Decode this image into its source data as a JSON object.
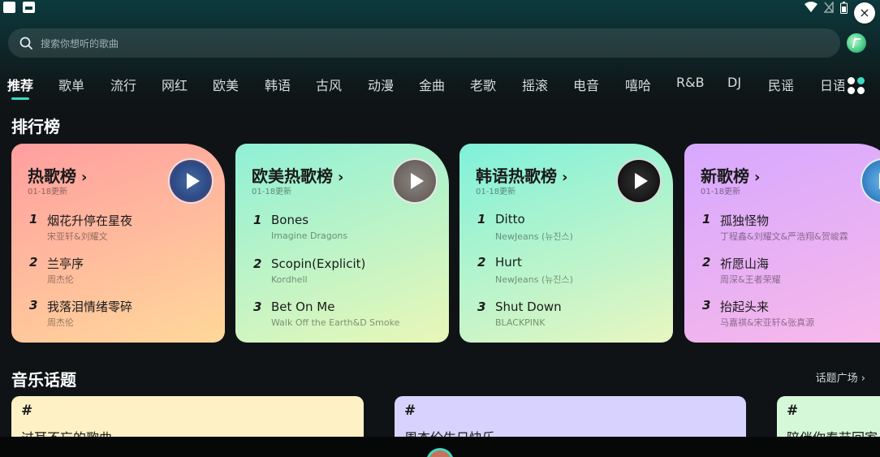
{
  "status_bar": {
    "left_icons": [
      "notification-icon",
      "image-icon"
    ],
    "right_icons": [
      "wifi-icon",
      "no-signal-icon",
      "battery-icon"
    ]
  },
  "overlay": {
    "close_label": "×"
  },
  "search": {
    "placeholder": "搜索你想听的歌曲"
  },
  "tabs": [
    {
      "label": "推荐",
      "active": true
    },
    {
      "label": "歌单"
    },
    {
      "label": "流行"
    },
    {
      "label": "网红"
    },
    {
      "label": "欧美"
    },
    {
      "label": "韩语"
    },
    {
      "label": "古风"
    },
    {
      "label": "动漫"
    },
    {
      "label": "金曲"
    },
    {
      "label": "老歌"
    },
    {
      "label": "摇滚"
    },
    {
      "label": "电音"
    },
    {
      "label": "嘻哈"
    },
    {
      "label": "R&B"
    },
    {
      "label": "DJ"
    },
    {
      "label": "民谣"
    },
    {
      "label": "日语"
    }
  ],
  "charts_section": {
    "title": "排行榜"
  },
  "charts": [
    {
      "title": "热歌榜",
      "chevron": "›",
      "date": "01-18更新",
      "colors": [
        "#ff9ea0",
        "#ffd89a"
      ],
      "songs": [
        {
          "rank": "1",
          "title": "烟花升停在星夜",
          "artist": "宋亚轩&刘耀文"
        },
        {
          "rank": "2",
          "title": "兰亭序",
          "artist": "周杰伦"
        },
        {
          "rank": "3",
          "title": "我落泪情绪零碎",
          "artist": "周杰伦"
        }
      ]
    },
    {
      "title": "欧美热歌榜",
      "chevron": "›",
      "date": "01-18更新",
      "colors": [
        "#8ff0d6",
        "#e9f7b8"
      ],
      "songs": [
        {
          "rank": "1",
          "title": "Bones",
          "artist": "Imagine Dragons"
        },
        {
          "rank": "2",
          "title": "Scopin(Explicit)",
          "artist": "Kordhell"
        },
        {
          "rank": "3",
          "title": "Bet On Me",
          "artist": "Walk Off the Earth&D Smoke"
        }
      ]
    },
    {
      "title": "韩语热歌榜",
      "chevron": "›",
      "date": "01-18更新",
      "colors": [
        "#7ff1da",
        "#e8f6c0"
      ],
      "songs": [
        {
          "rank": "1",
          "title": "Ditto",
          "artist": "NewJeans (뉴진스)"
        },
        {
          "rank": "2",
          "title": "Hurt",
          "artist": "NewJeans (뉴진스)"
        },
        {
          "rank": "3",
          "title": "Shut Down",
          "artist": "BLACKPINK"
        }
      ]
    },
    {
      "title": "新歌榜",
      "chevron": "›",
      "date": "01-18更新",
      "colors": [
        "#d6a8ff",
        "#f9b9e9"
      ],
      "songs": [
        {
          "rank": "1",
          "title": "孤独怪物",
          "artist": "丁程鑫&刘耀文&严浩翔&贺峻霖"
        },
        {
          "rank": "2",
          "title": "祈愿山海",
          "artist": "周深&王者荣耀"
        },
        {
          "rank": "3",
          "title": "抬起头来",
          "artist": "马嘉祺&宋亚轩&张真源"
        }
      ]
    }
  ],
  "topics_section": {
    "title": "音乐话题",
    "more_label": "话题广场 ›"
  },
  "topics": [
    {
      "hash": "#",
      "text": "过耳不忘的歌曲",
      "color": "#fff1c6"
    },
    {
      "hash": "#",
      "text": "周杰伦生日快乐",
      "color": "#d8d2ff"
    },
    {
      "hash": "#",
      "text": "陪伴你春节回家",
      "color": "#d5f8d8"
    }
  ]
}
